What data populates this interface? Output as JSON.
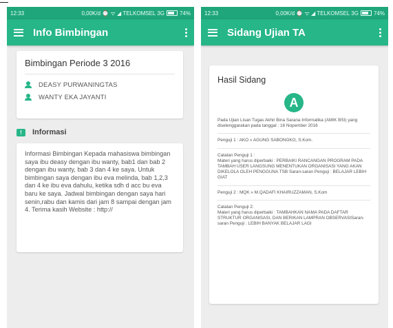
{
  "left": {
    "status_bar": {
      "time": "12:33",
      "info": "0,00K/d ⌚ ᯤ ◢ TELKOMSEL 3G",
      "battery": "74%"
    },
    "appbar": {
      "title": "Info Bimbingan"
    },
    "period_card": {
      "title": "Bimbingan Periode 3 2016",
      "people": [
        "DEASY PURWANINGTAS",
        "WANTY EKA JAYANTI"
      ]
    },
    "info": {
      "heading": "Informasi",
      "body": "Informasi Bimbingan Kepada mahasiswa bimbingan saya ibu deasy dengan ibu wanty, bab1 dan bab 2 dengan ibu wanty, bab 3 dan 4 ke saya. Untuk bimbingan saya dengan ibu eva melinda, bab 1,2,3 dan 4 ke ibu eva dahulu, ketika sdh d acc bu eva baru ke saya. Jadwal bimbingan dengan saya hari senin,rabu dan kamis dari jam 8 sampai dengan jam 4. Terima kasih Website : http://"
    }
  },
  "right": {
    "status_bar": {
      "time": "12:33",
      "info": "0,00K/d ⌚ ᯤ ◢ TELKOMSEL 3G",
      "battery": "74%"
    },
    "appbar": {
      "title": "Sidang Ujian TA"
    },
    "result": {
      "title": "Hasil Sidang",
      "grade": "A",
      "intro": "Pada Ujian Lisan Tugas Akhir Bina Sarana Informatika (AMIK BSI) yang diselenggarakan pada tanggal : 16 Nopember 2016",
      "penguji1": "Penguji 1 : AKO » AGUNG SABONGKO, S.Kom.",
      "catatan1_label": "Catatan Penguji 1 :",
      "catatan1": "Materi yang harus diperbaiki : PERBAIKI RANCANGAN PROGRAM PADA TAMBAH USER LANGSUNG MENENTUKAN ORGANISASI YANG AKAN DIKELOLA OLEH PENGGUNA TSB Saran-saran Penguji : BELAJAR LEBIH GIAT",
      "penguji2": "Penguji 2 : MQK » M.QADAFI KHAIRUZZAMAN, S.Kom",
      "catatan2_label": "Catatan Penguji 2:",
      "catatan2": "Materi yang harus diperbaiki : TAMBAHKAN NAMA PADA DAFTAR STRUKTUR ORGANISASI, DAN BERIKAN LAMPRAN OBSERVASISaran-saran Penguji : LEBIH BANYAK BELAJAR LAGI"
    }
  }
}
